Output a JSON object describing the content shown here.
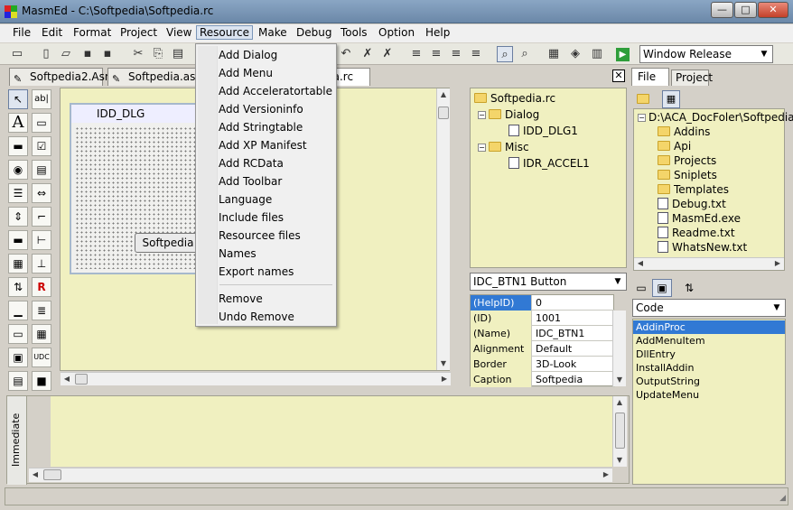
{
  "window": {
    "title": "MasmEd - C:\\Softpedia\\Softpedia.rc",
    "min": "—",
    "max": "□",
    "close": "✕"
  },
  "menubar": [
    "File",
    "Edit",
    "Format",
    "Project",
    "View",
    "Resource",
    "Make",
    "Debug",
    "Tools",
    "Option",
    "Help"
  ],
  "active_menu": "Resource",
  "build_mode": "Window Release",
  "tabs": [
    "Softpedia2.Asm",
    "Softpedia.asm",
    "Softpedia.rc"
  ],
  "toolbox": {
    "label_tool": "A",
    "edit_tool": "ab|",
    "check_tool": "☑",
    "radio_tool": "◉",
    "udc_tool": "UDC",
    "image_tool": "✎"
  },
  "dialog": {
    "title": "IDD_DLG",
    "button_label": "Softpedia"
  },
  "resource_tree": {
    "root": "Softpedia.rc",
    "dialog_folder": "Dialog",
    "dialog_item": "IDD_DLG1",
    "misc_folder": "Misc",
    "misc_item": "IDR_ACCEL1"
  },
  "resource_menu": {
    "items": [
      "Add Dialog",
      "Add Menu",
      "Add Acceleratortable",
      "Add Versioninfo",
      "Add Stringtable",
      "Add XP Manifest",
      "Add RCData",
      "Add Toolbar",
      "Language",
      "Include files",
      "Resourcee files",
      "Names",
      "Export names"
    ],
    "items2": [
      "Remove",
      "Undo Remove"
    ]
  },
  "property_selector": "IDC_BTN1 Button",
  "properties": [
    {
      "k": "(HelpID)",
      "v": "0"
    },
    {
      "k": "(ID)",
      "v": "1001"
    },
    {
      "k": "(Name)",
      "v": "IDC_BTN1"
    },
    {
      "k": "Alignment",
      "v": "Default"
    },
    {
      "k": "Border",
      "v": "3D-Look"
    },
    {
      "k": "Caption",
      "v": "Softpedia"
    }
  ],
  "right_tabs": [
    "File",
    "Project"
  ],
  "file_tree": {
    "root": "D:\\ACA_DocFoler\\Softpedia",
    "items": [
      "Addins",
      "Api",
      "Projects",
      "Sniplets",
      "Templates",
      "Debug.txt",
      "MasmEd.exe",
      "Readme.txt",
      "WhatsNew.txt"
    ]
  },
  "code_selector": "Code",
  "code_list": [
    "AddinProc",
    "AddMenuItem",
    "DllEntry",
    "InstallAddin",
    "OutputString",
    "UpdateMenu"
  ],
  "immediate_label": "Immediate",
  "colors": {
    "selection": "#3179d4",
    "panel_bg": "#f0f0c0"
  }
}
